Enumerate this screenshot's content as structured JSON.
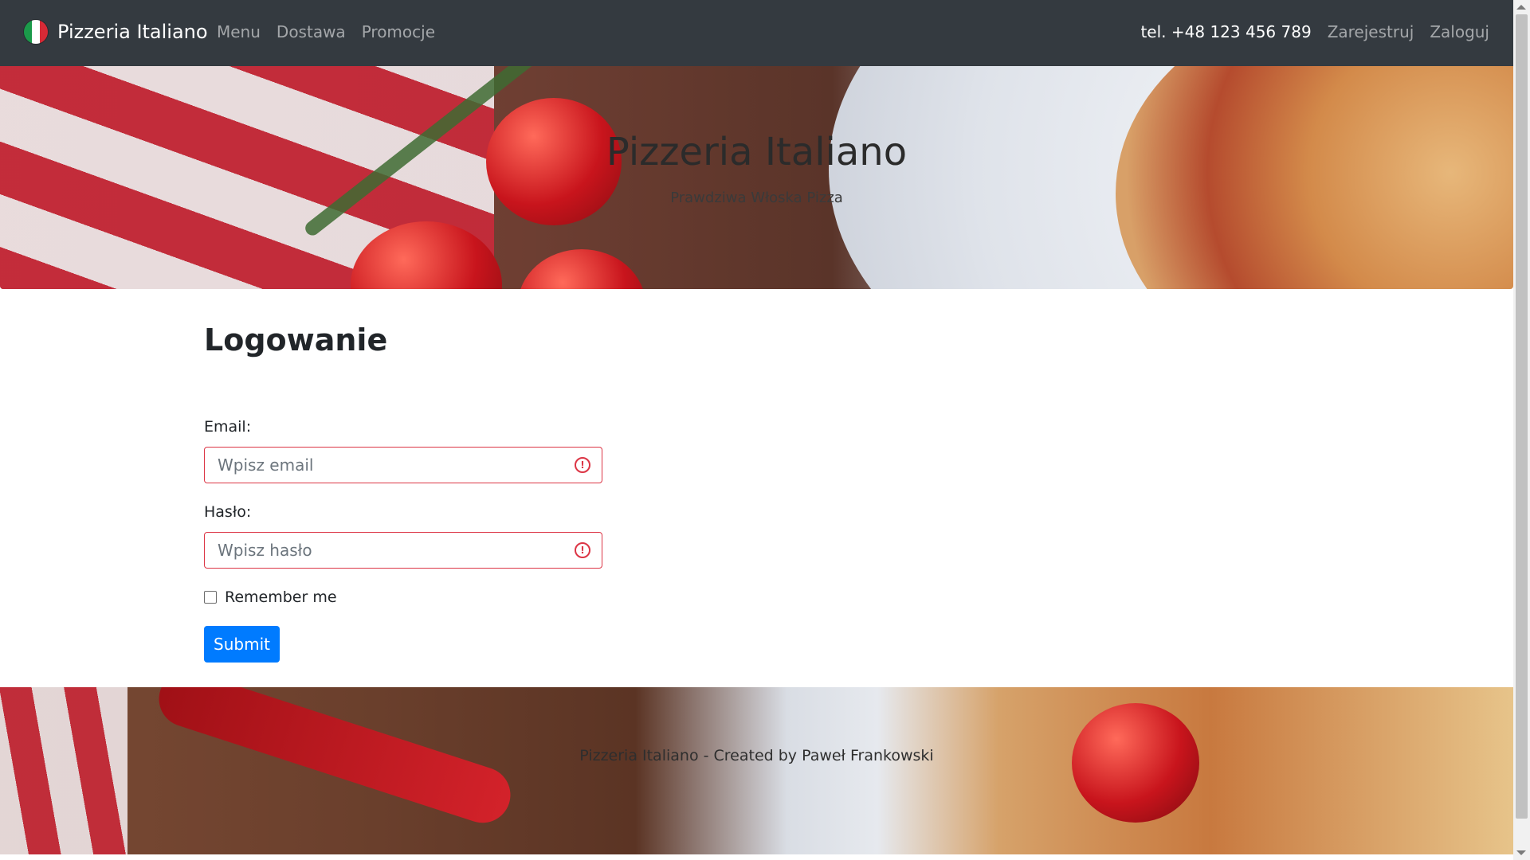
{
  "navbar": {
    "brand": "Pizzeria Italiano",
    "flag_icon": "italy-flag-icon",
    "links": [
      "Menu",
      "Dostawa",
      "Promocje"
    ],
    "phone": "tel. +48 123 456 789",
    "register": "Zarejestruj",
    "login": "Zaloguj"
  },
  "hero": {
    "title": "Pizzeria Italiano",
    "subtitle": "Prawdziwa Włoska Pizza"
  },
  "login_form": {
    "title": "Logowanie",
    "email_label": "Email:",
    "email_placeholder": "Wpisz email",
    "password_label": "Hasło:",
    "password_placeholder": "Wpisz hasło",
    "remember_label": "Remember me",
    "submit_label": "Submit",
    "invalid_icon": "exclamation-circle-icon"
  },
  "footer": {
    "text": "Pizzeria Italiano - Created by Paweł Frankowski"
  },
  "colors": {
    "navbar_bg": "#343a40",
    "primary": "#007bff",
    "danger": "#dc3545"
  }
}
